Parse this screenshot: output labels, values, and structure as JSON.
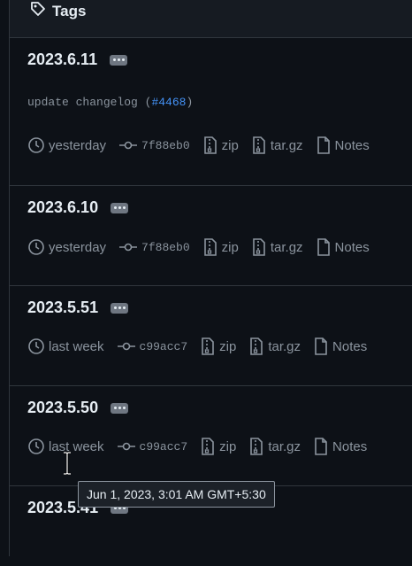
{
  "header": {
    "title": "Tags"
  },
  "tags": [
    {
      "name": "2023.6.11",
      "message_prefix": "update changelog (",
      "message_link": "#4468",
      "message_suffix": ")",
      "date": "yesterday",
      "commit": "7f88eb0",
      "zip": "zip",
      "targz": "tar.gz",
      "notes": "Notes"
    },
    {
      "name": "2023.6.10",
      "date": "yesterday",
      "commit": "7f88eb0",
      "zip": "zip",
      "targz": "tar.gz",
      "notes": "Notes"
    },
    {
      "name": "2023.5.51",
      "date": "last week",
      "commit": "c99acc7",
      "zip": "zip",
      "targz": "tar.gz",
      "notes": "Notes"
    },
    {
      "name": "2023.5.50",
      "date": "last week",
      "commit": "c99acc7",
      "zip": "zip",
      "targz": "tar.gz",
      "notes": "Notes"
    },
    {
      "name": "2023.5.41"
    }
  ],
  "tooltip": {
    "text": "Jun 1, 2023, 3:01 AM GMT+5:30"
  },
  "colors": {
    "bg": "#0d1117",
    "header_bg": "#161b22",
    "muted": "#8b949e",
    "link": "#4493f8",
    "border": "#30363d"
  }
}
